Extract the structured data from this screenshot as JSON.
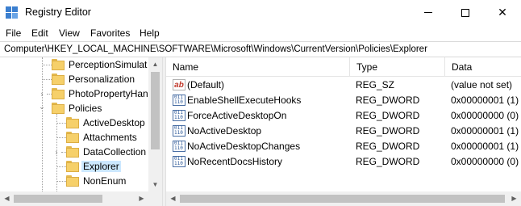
{
  "window": {
    "title": "Registry Editor",
    "app_icon": "registry-editor-icon",
    "controls": [
      "minimize-icon",
      "maximize-icon",
      "close-icon"
    ],
    "close_glyph": "✕"
  },
  "menu": [
    "File",
    "Edit",
    "View",
    "Favorites",
    "Help"
  ],
  "address": "Computer\\HKEY_LOCAL_MACHINE\\SOFTWARE\\Microsoft\\Windows\\CurrentVersion\\Policies\\Explorer",
  "tree": [
    {
      "label": "PerceptionSimulat",
      "level": 1,
      "expander": ""
    },
    {
      "label": "Personalization",
      "level": 1,
      "expander": ""
    },
    {
      "label": "PhotoPropertyHan",
      "level": 1,
      "expander": "›"
    },
    {
      "label": "Policies",
      "level": 1,
      "expander": "⌄"
    },
    {
      "label": "ActiveDesktop",
      "level": 2,
      "expander": ""
    },
    {
      "label": "Attachments",
      "level": 2,
      "expander": ""
    },
    {
      "label": "DataCollection",
      "level": 2,
      "expander": "›"
    },
    {
      "label": "Explorer",
      "level": 2,
      "expander": "",
      "selected": true
    },
    {
      "label": "NonEnum",
      "level": 2,
      "expander": ""
    }
  ],
  "list": {
    "columns": [
      "Name",
      "Type",
      "Data"
    ],
    "rows": [
      {
        "name": "(Default)",
        "type": "REG_SZ",
        "data": "(value not set)",
        "icon": "string-value-icon"
      },
      {
        "name": "EnableShellExecuteHooks",
        "type": "REG_DWORD",
        "data": "0x00000001 (1)",
        "icon": "dword-value-icon"
      },
      {
        "name": "ForceActiveDesktopOn",
        "type": "REG_DWORD",
        "data": "0x00000000 (0)",
        "icon": "dword-value-icon"
      },
      {
        "name": "NoActiveDesktop",
        "type": "REG_DWORD",
        "data": "0x00000001 (1)",
        "icon": "dword-value-icon"
      },
      {
        "name": "NoActiveDesktopChanges",
        "type": "REG_DWORD",
        "data": "0x00000001 (1)",
        "icon": "dword-value-icon"
      },
      {
        "name": "NoRecentDocsHistory",
        "type": "REG_DWORD",
        "data": "0x00000000 (0)",
        "icon": "dword-value-icon"
      }
    ]
  },
  "colors": {
    "selection": "#cce8ff",
    "folder": "#f6d06a",
    "accent": "#3b7fd0"
  }
}
